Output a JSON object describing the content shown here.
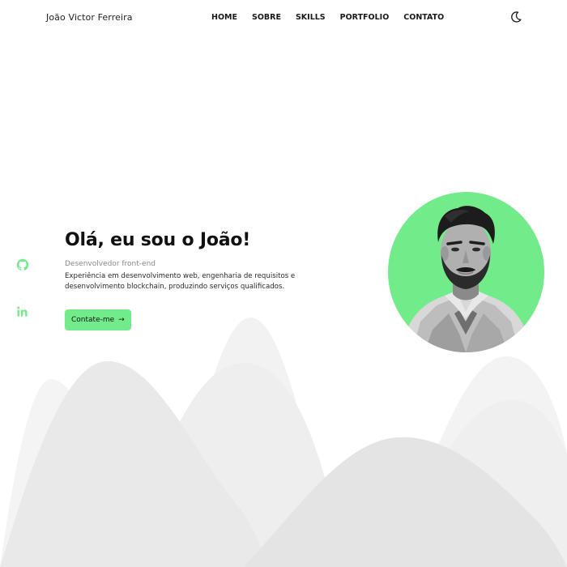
{
  "header": {
    "brand": "João Victor Ferreira",
    "nav": [
      "HOME",
      "SOBRE",
      "SKILLS",
      "PORTFOLIO",
      "CONTATO"
    ],
    "theme_toggle_icon": "moon-icon"
  },
  "social": [
    {
      "name": "github",
      "icon": "github-icon"
    },
    {
      "name": "linkedin",
      "icon": "linkedin-icon"
    }
  ],
  "hero": {
    "title": "Olá, eu sou o João!",
    "subtitle": "Desenvolvedor front-end",
    "description": "Experiência em desenvolvimento web, engenharia de requisitos e desenvolvimento blockchain, produzindo serviços qualificados.",
    "cta_label": "Contate-me",
    "cta_icon": "→"
  },
  "colors": {
    "accent": "#72ec8a",
    "mountain_light": "#f5f5f5",
    "mountain_mid": "#ececec",
    "mountain_dark": "#e4e4e4"
  }
}
